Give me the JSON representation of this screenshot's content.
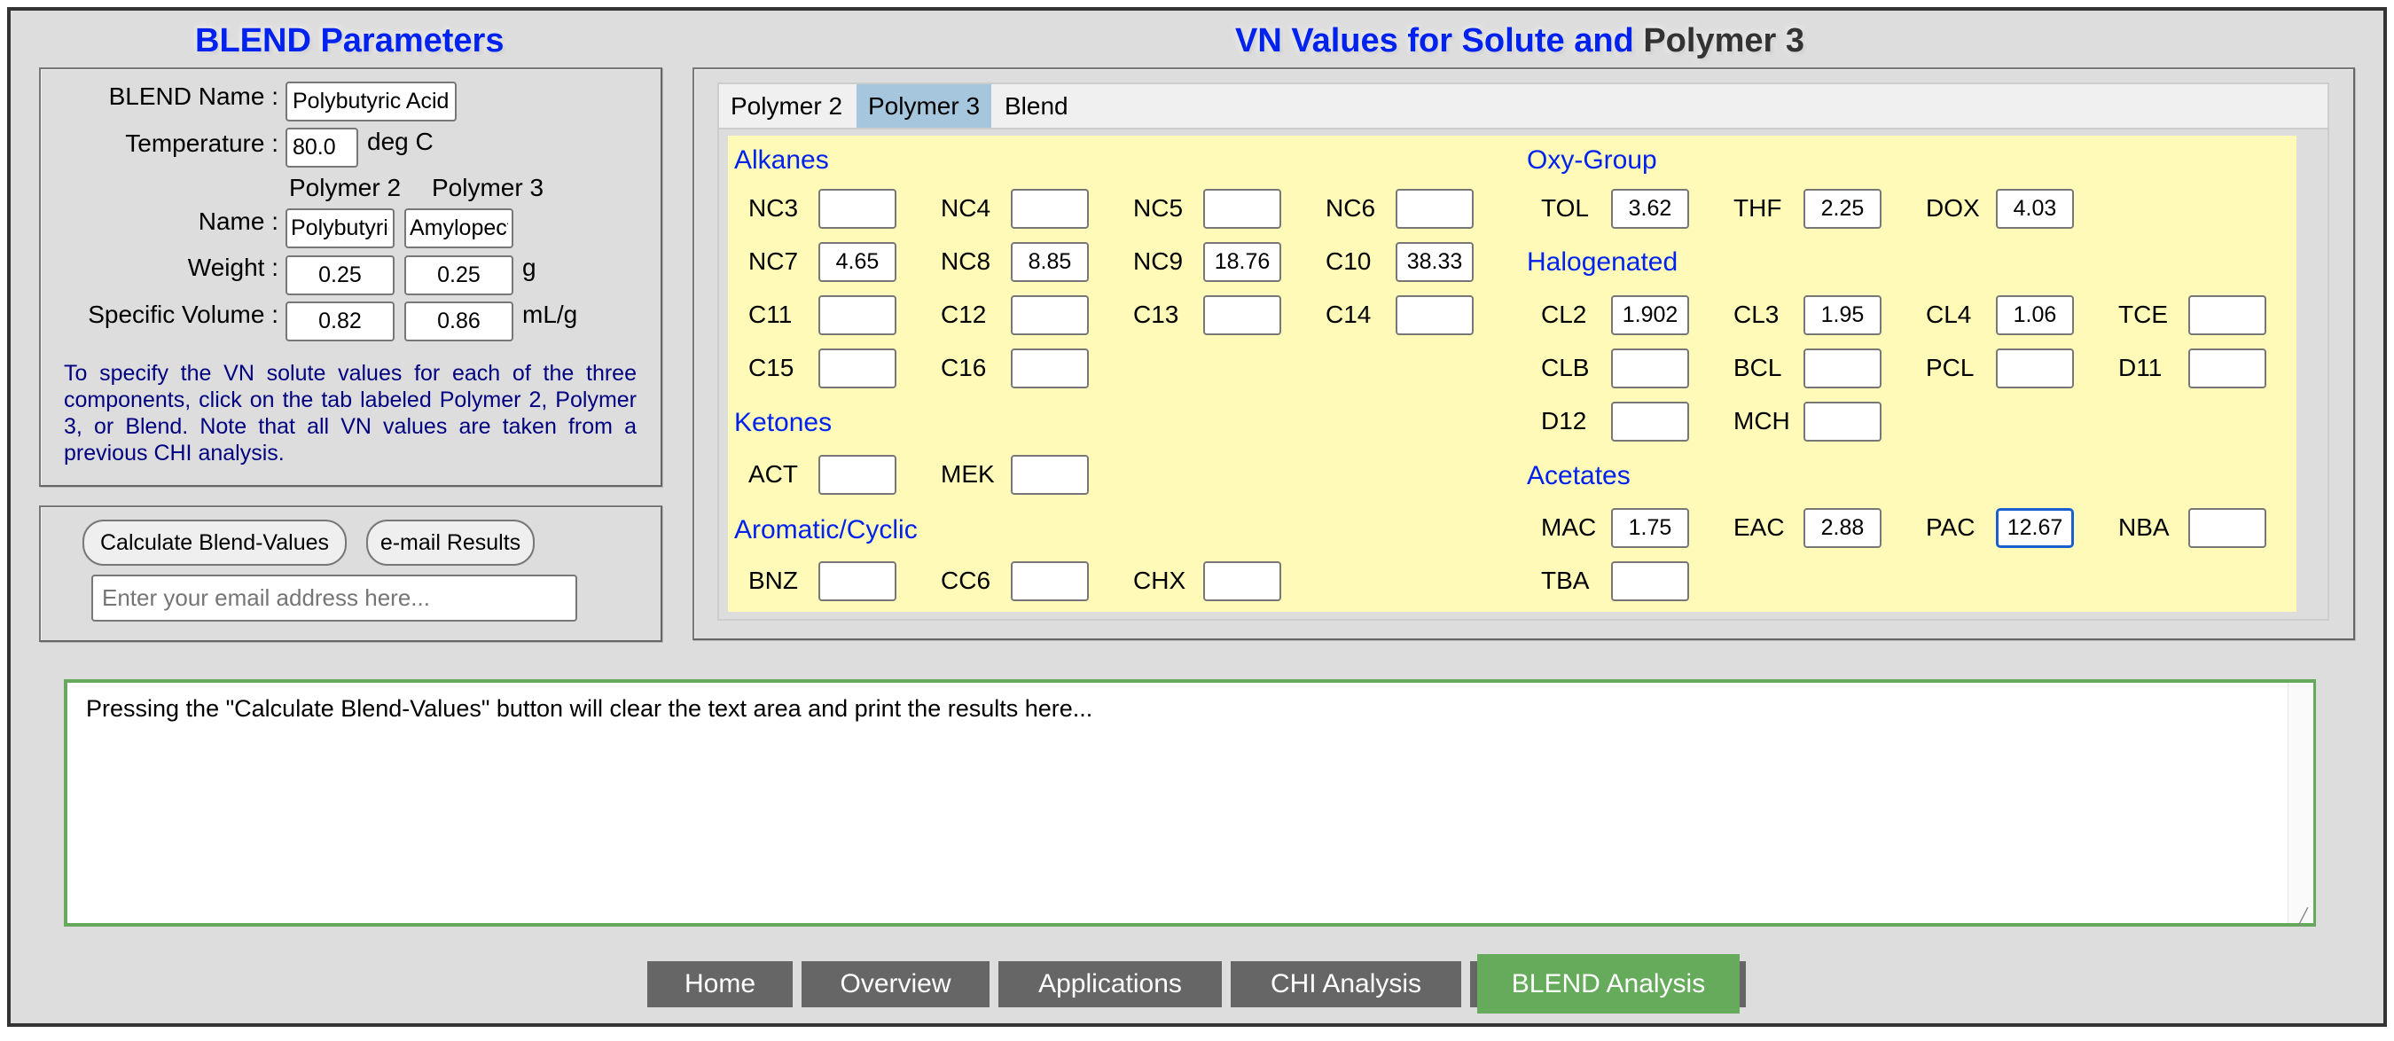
{
  "left_panel": {
    "title": "BLEND Parameters",
    "blend_name_label": "BLEND Name :",
    "blend_name_value": "Polybutyric Acid",
    "temperature_label": "Temperature :",
    "temperature_value": "80.0",
    "temperature_unit": "deg C",
    "polymer2_header": "Polymer 2",
    "polymer3_header": "Polymer 3",
    "name_label": "Name :",
    "polymer2_name": "Polybutyric Acid",
    "polymer3_name": "Amylopectin",
    "weight_label": "Weight :",
    "polymer2_weight": "0.25",
    "polymer3_weight": "0.25",
    "weight_unit": "g",
    "specific_volume_label": "Specific Volume :",
    "polymer2_specific_volume": "0.82",
    "polymer3_specific_volume": "0.86",
    "specific_volume_unit": "mL/g",
    "info_text": "To specify the VN solute values for each of the three components, click on the tab labeled Polymer 2, Polymer 3, or Blend. Note that all VN values are taken from a previous CHI analysis."
  },
  "actions": {
    "calculate_label": "Calculate Blend-Values",
    "email_label": "e-mail Results",
    "email_placeholder": "Enter your email address here...",
    "email_value": ""
  },
  "right_panel": {
    "title_part1": "VN Values for Solute and",
    "title_part2": "Polymer 3",
    "tabs": [
      {
        "label": "Polymer 2",
        "active": false
      },
      {
        "label": "Polymer 3",
        "active": true
      },
      {
        "label": "Blend",
        "active": false
      }
    ],
    "groups": {
      "alkanes": {
        "heading": "Alkanes",
        "fields": [
          {
            "label": "NC3",
            "value": ""
          },
          {
            "label": "NC4",
            "value": ""
          },
          {
            "label": "NC5",
            "value": ""
          },
          {
            "label": "NC6",
            "value": ""
          },
          {
            "label": "NC7",
            "value": "4.65"
          },
          {
            "label": "NC8",
            "value": "8.85"
          },
          {
            "label": "NC9",
            "value": "18.76"
          },
          {
            "label": "C10",
            "value": "38.33"
          },
          {
            "label": "C11",
            "value": ""
          },
          {
            "label": "C12",
            "value": ""
          },
          {
            "label": "C13",
            "value": ""
          },
          {
            "label": "C14",
            "value": ""
          },
          {
            "label": "C15",
            "value": ""
          },
          {
            "label": "C16",
            "value": ""
          }
        ]
      },
      "ketones": {
        "heading": "Ketones",
        "fields": [
          {
            "label": "ACT",
            "value": ""
          },
          {
            "label": "MEK",
            "value": ""
          }
        ]
      },
      "aromatic": {
        "heading": "Aromatic/Cyclic",
        "fields": [
          {
            "label": "BNZ",
            "value": ""
          },
          {
            "label": "CC6",
            "value": ""
          },
          {
            "label": "CHX",
            "value": ""
          }
        ]
      },
      "oxy": {
        "heading": "Oxy-Group",
        "fields": [
          {
            "label": "TOL",
            "value": "3.62"
          },
          {
            "label": "THF",
            "value": "2.25"
          },
          {
            "label": "DOX",
            "value": "4.03"
          }
        ]
      },
      "halogenated": {
        "heading": "Halogenated",
        "fields": [
          {
            "label": "CL2",
            "value": "1.902"
          },
          {
            "label": "CL3",
            "value": "1.95"
          },
          {
            "label": "CL4",
            "value": "1.06"
          },
          {
            "label": "TCE",
            "value": ""
          },
          {
            "label": "CLB",
            "value": ""
          },
          {
            "label": "BCL",
            "value": ""
          },
          {
            "label": "PCL",
            "value": ""
          },
          {
            "label": "D11",
            "value": ""
          },
          {
            "label": "D12",
            "value": ""
          },
          {
            "label": "MCH",
            "value": ""
          }
        ]
      },
      "acetates": {
        "heading": "Acetates",
        "fields": [
          {
            "label": "MAC",
            "value": "1.75"
          },
          {
            "label": "EAC",
            "value": "2.88"
          },
          {
            "label": "PAC",
            "value": "12.67",
            "focused": true
          },
          {
            "label": "NBA",
            "value": ""
          },
          {
            "label": "TBA",
            "value": ""
          }
        ]
      }
    }
  },
  "results": {
    "text": "Pressing the \"Calculate Blend-Values\" button will clear the text area and print the results here..."
  },
  "nav": {
    "items": [
      {
        "label": "Home",
        "active": false
      },
      {
        "label": "Overview",
        "active": false
      },
      {
        "label": "Applications",
        "active": false
      },
      {
        "label": "CHI Analysis",
        "active": false
      },
      {
        "label": "BLEND Analysis",
        "active": true
      }
    ]
  },
  "colors": {
    "title_blue": "#0022ee",
    "tab_active": "#a6c6de",
    "panel_yellow": "#fffab8",
    "nav_gray": "#666666",
    "nav_active_green": "#66ab5c",
    "results_border_green": "#66a85c",
    "info_text_navy": "#000080"
  }
}
